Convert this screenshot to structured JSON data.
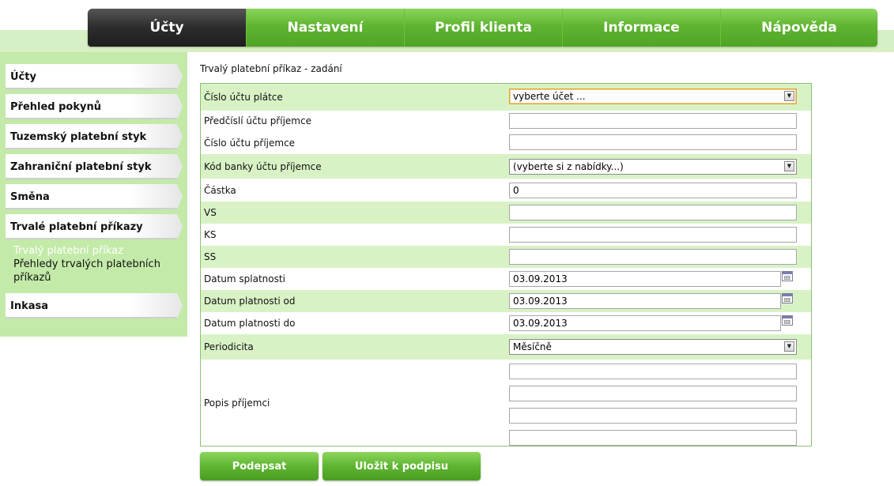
{
  "nav": {
    "tabs": [
      {
        "label": "Účty",
        "active": true
      },
      {
        "label": "Nastavení",
        "active": false
      },
      {
        "label": "Profil klienta",
        "active": false
      },
      {
        "label": "Informace",
        "active": false
      },
      {
        "label": "Nápověda",
        "active": false
      }
    ]
  },
  "sidebar": {
    "items": [
      {
        "label": "Účty"
      },
      {
        "label": "Přehled pokynů"
      },
      {
        "label": "Tuzemský platební styk"
      },
      {
        "label": "Zahraniční platební styk"
      },
      {
        "label": "Směna"
      },
      {
        "label": "Trvalé platební příkazy"
      },
      {
        "label": "Inkasa"
      }
    ],
    "subitems": [
      {
        "label": "Trvalý platební příkaz",
        "active": true
      },
      {
        "label": "Přehledy trvalých platebních příkazů",
        "active": false
      }
    ]
  },
  "form": {
    "title": "Trvalý platební příkaz - zadání",
    "fields": {
      "payer_account": {
        "label": "Číslo účtu plátce",
        "value": "vyberte účet ..."
      },
      "recipient_prefix": {
        "label": "Předčíslí účtu příjemce",
        "value": ""
      },
      "recipient_account": {
        "label": "Číslo účtu příjemce",
        "value": ""
      },
      "bank_code": {
        "label": "Kód banky účtu příjemce",
        "value": "(vyberte si z nabídky...)"
      },
      "amount": {
        "label": "Částka",
        "value": "0"
      },
      "vs": {
        "label": "VS",
        "value": ""
      },
      "ks": {
        "label": "KS",
        "value": ""
      },
      "ss": {
        "label": "SS",
        "value": ""
      },
      "due_date": {
        "label": "Datum splatnosti",
        "value": "03.09.2013"
      },
      "valid_from": {
        "label": "Datum platnosti od",
        "value": "03.09.2013"
      },
      "valid_to": {
        "label": "Datum platnosti do",
        "value": "03.09.2013"
      },
      "periodicity": {
        "label": "Periodicita",
        "value": "Měsíčně"
      },
      "description": {
        "label": "Popis příjemci",
        "lines": [
          "",
          "",
          "",
          ""
        ]
      }
    }
  },
  "buttons": {
    "sign": "Podepsat",
    "save_for_signing": "Uložit k podpisu"
  },
  "colors": {
    "accent_green": "#5fb531",
    "sidebar_bg": "#c3eaa8",
    "row_alt": "#d8f2c6",
    "active_tab": "#2c2c2c"
  }
}
